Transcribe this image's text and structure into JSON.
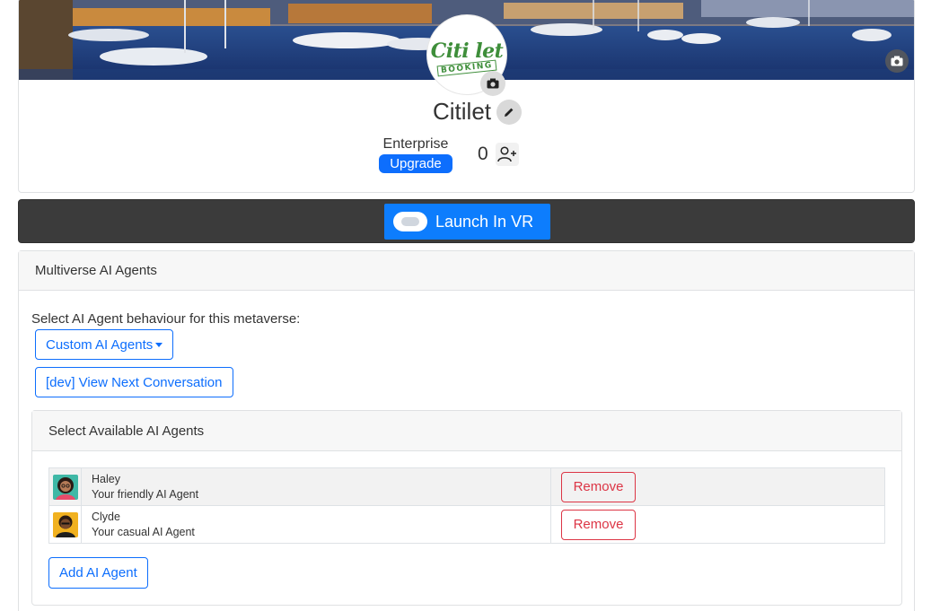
{
  "profile": {
    "name": "Citilet",
    "logo_text": "Citi let",
    "logo_subtext": "BOOKING",
    "plan": "Enterprise",
    "upgrade_label": "Upgrade",
    "member_count": "0"
  },
  "vr": {
    "launch_label": "Launch In VR"
  },
  "multiverse": {
    "title": "Multiverse AI Agents",
    "intro": "Select AI Agent behaviour for this metaverse:",
    "behaviour_selected": "Custom AI Agents",
    "dev_button": "[dev] View Next Conversation",
    "agents_panel": {
      "title": "Select Available AI Agents",
      "agents": [
        {
          "name": "Haley",
          "description": "Your friendly AI Agent",
          "action": "Remove",
          "avatar_icon": "female-avatar-icon"
        },
        {
          "name": "Clyde",
          "description": "Your casual AI Agent",
          "action": "Remove",
          "avatar_icon": "male-avatar-icon"
        }
      ],
      "add_label": "Add AI Agent"
    }
  },
  "colors": {
    "primary": "#0d6efd",
    "danger": "#dc3545",
    "vr_bar": "#3b3b3b",
    "logo_green": "#3e8e3a"
  }
}
